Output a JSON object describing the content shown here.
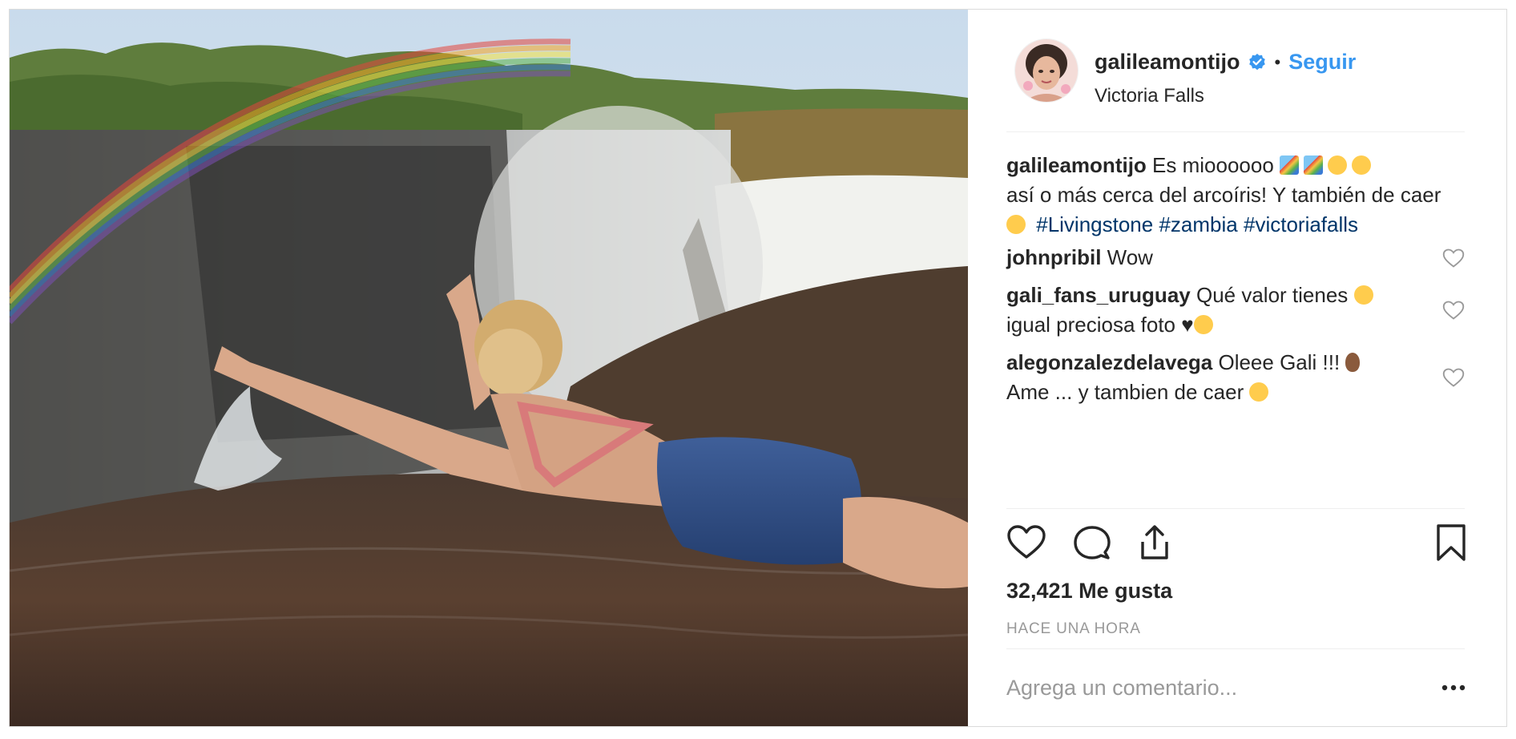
{
  "post": {
    "username": "galileamontijo",
    "follow_label": "Seguir",
    "separator": "•",
    "location": "Victoria Falls",
    "verified": true
  },
  "caption": {
    "username": "galileamontijo",
    "text_1": "Es mioooooo",
    "text_2": "así o más cerca del arcoíris! Y también de caer",
    "hashtags": [
      "#Livingstone",
      "#zambia",
      "#victoriafalls"
    ],
    "emojis": [
      "rainbow",
      "rainbow",
      "heart-eyes",
      "heart-eyes",
      "sweat-smile"
    ]
  },
  "comments": [
    {
      "username": "johnpribil",
      "text": "Wow"
    },
    {
      "username": "gali_fans_uruguay",
      "text": "Qué valor tienes",
      "text_2": "igual preciosa foto ♥",
      "emojis": [
        "tears-of-joy",
        "heart-eyes"
      ]
    },
    {
      "username": "alegonzalezdelavega",
      "text": "Oleee Gali !!!",
      "text_2": "Ame ... y tambien de caer",
      "emojis": [
        "ok-hand",
        "tears-of-joy"
      ]
    }
  ],
  "stats": {
    "likes": "32,421 Me gusta",
    "time": "HACE UNA HORA"
  },
  "comment_box": {
    "placeholder": "Agrega un comentario..."
  },
  "icons": {
    "like": "heart-outline-icon",
    "comment": "comment-bubble-icon",
    "share": "share-icon",
    "save": "bookmark-icon",
    "more": "ellipsis-icon",
    "verified": "verified-badge-icon"
  },
  "colors": {
    "link": "#3897f0",
    "hashtag": "#003569",
    "text": "#262626",
    "muted": "#999999",
    "border": "#efefef"
  }
}
